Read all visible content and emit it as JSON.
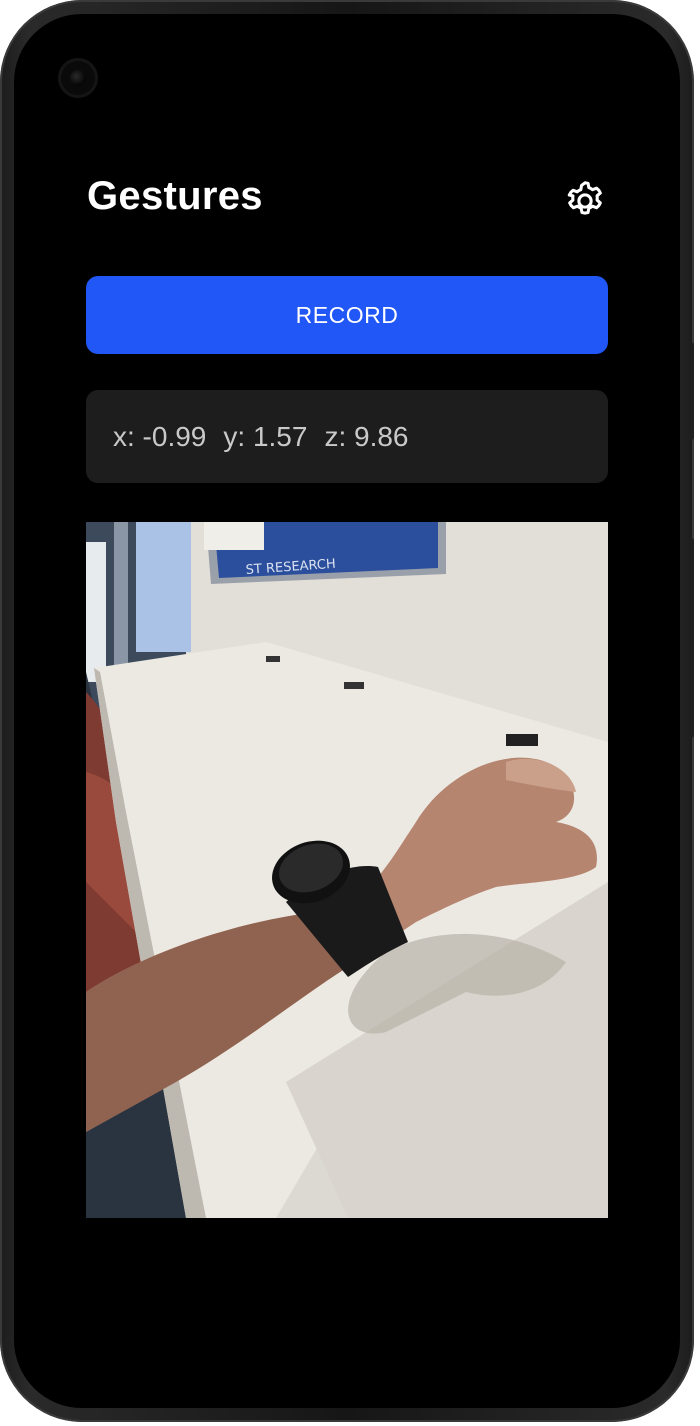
{
  "app": {
    "title": "Gestures"
  },
  "toolbar": {
    "settings_icon": "gear-icon"
  },
  "record_button": {
    "label": "RECORD"
  },
  "accelerometer": {
    "x": "x: -0.99",
    "y": "y: 1.57",
    "z": "z: 9.86"
  },
  "camera_preview": {
    "poster_text": "ST RESEARCH"
  },
  "colors": {
    "accent": "#2156f7",
    "background": "#000000",
    "card": "#1d1d1d"
  }
}
